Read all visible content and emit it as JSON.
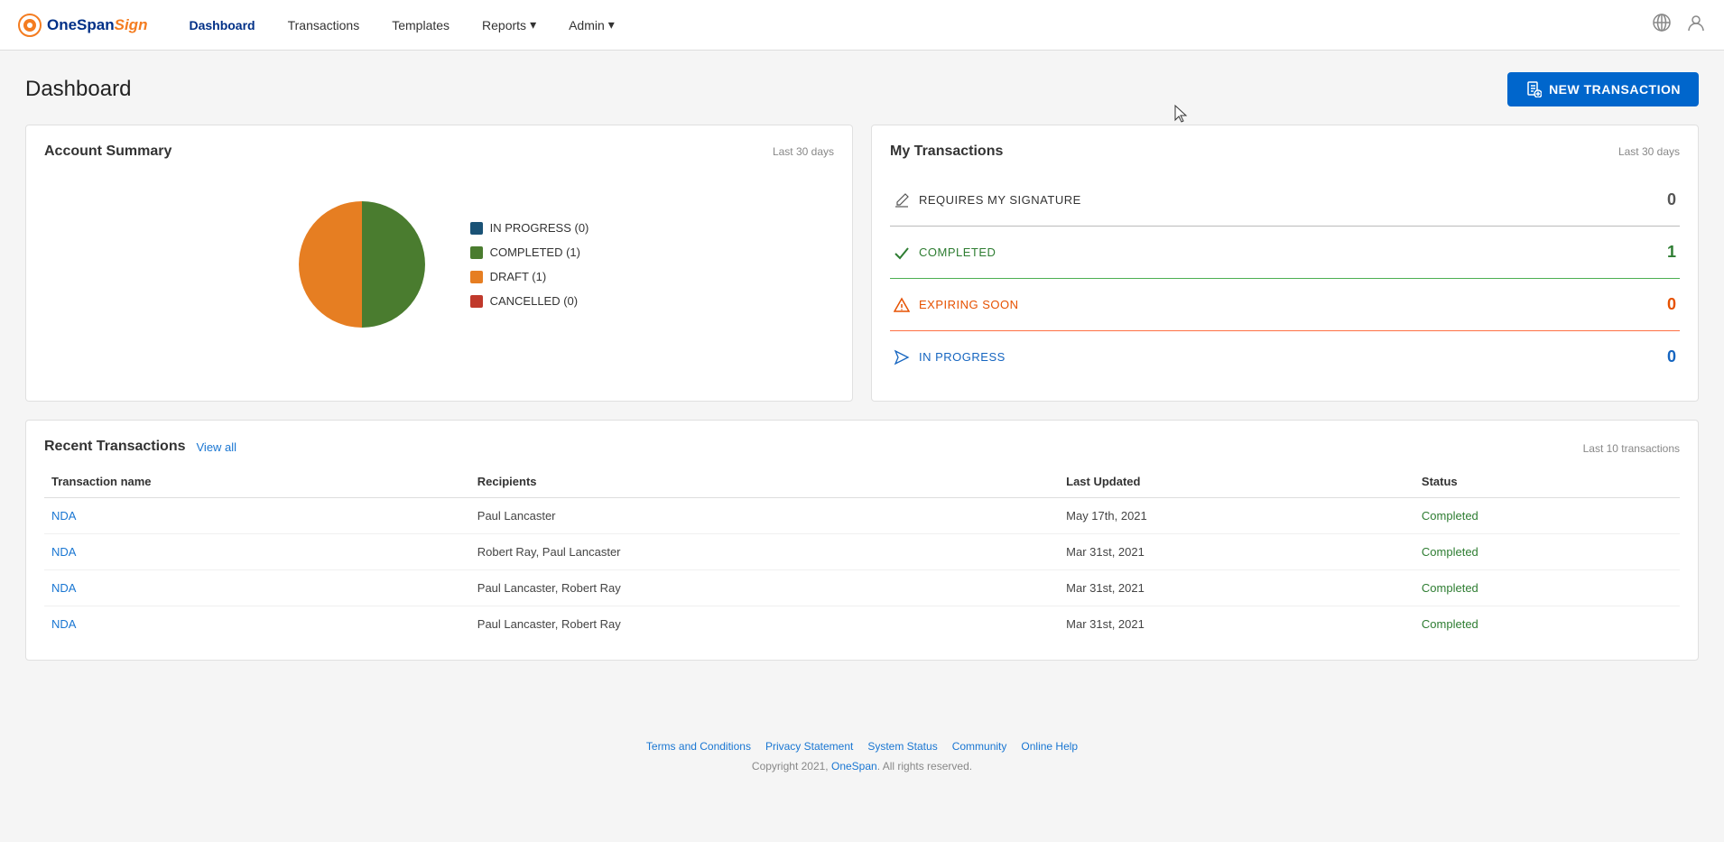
{
  "brand": {
    "name_part1": "OneSpan",
    "name_part2": "Sign"
  },
  "nav": {
    "links": [
      {
        "label": "Dashboard",
        "active": true
      },
      {
        "label": "Transactions",
        "active": false
      },
      {
        "label": "Templates",
        "active": false
      },
      {
        "label": "Reports",
        "active": false,
        "has_dropdown": true
      },
      {
        "label": "Admin",
        "active": false,
        "has_dropdown": true
      }
    ]
  },
  "page": {
    "title": "Dashboard",
    "new_transaction_btn": "NEW TRANSACTION",
    "last_30_days": "Last 30 days",
    "last_10_transactions": "Last 10 transactions"
  },
  "account_summary": {
    "title": "Account Summary",
    "subtitle": "Last 30 days",
    "chart": {
      "segments": [
        {
          "label": "IN PROGRESS",
          "count": 0,
          "color": "#1a5276"
        },
        {
          "label": "COMPLETED",
          "count": 1,
          "color": "#4a7c2f"
        },
        {
          "label": "DRAFT",
          "count": 1,
          "color": "#e67e22"
        },
        {
          "label": "CANCELLED",
          "count": 0,
          "color": "#c0392b"
        }
      ]
    }
  },
  "my_transactions": {
    "title": "My Transactions",
    "subtitle": "Last 30 days",
    "rows": [
      {
        "icon": "pen",
        "label": "REQUIRES MY SIGNATURE",
        "count": "0",
        "color": "gray"
      },
      {
        "icon": "check",
        "label": "COMPLETED",
        "count": "1",
        "color": "green"
      },
      {
        "icon": "warning",
        "label": "EXPIRING SOON",
        "count": "0",
        "color": "orange"
      },
      {
        "icon": "send",
        "label": "IN PROGRESS",
        "count": "0",
        "color": "blue"
      }
    ]
  },
  "recent_transactions": {
    "title": "Recent Transactions",
    "view_all": "View all",
    "subtitle": "Last 10 transactions",
    "columns": [
      "Transaction name",
      "Recipients",
      "Last Updated",
      "Status"
    ],
    "rows": [
      {
        "name": "NDA",
        "recipients": "Paul Lancaster",
        "last_updated": "May 17th, 2021",
        "status": "Completed"
      },
      {
        "name": "NDA",
        "recipients": "Robert Ray, Paul Lancaster",
        "last_updated": "Mar 31st, 2021",
        "status": "Completed"
      },
      {
        "name": "NDA",
        "recipients": "Paul Lancaster, Robert Ray",
        "last_updated": "Mar 31st, 2021",
        "status": "Completed"
      },
      {
        "name": "NDA",
        "recipients": "Paul Lancaster, Robert Ray",
        "last_updated": "Mar 31st, 2021",
        "status": "Completed"
      }
    ]
  },
  "footer": {
    "links": [
      "Terms and Conditions",
      "Privacy Statement",
      "System Status",
      "Community",
      "Online Help"
    ],
    "copyright": "Copyright 2021, OneSpan. All rights reserved."
  }
}
